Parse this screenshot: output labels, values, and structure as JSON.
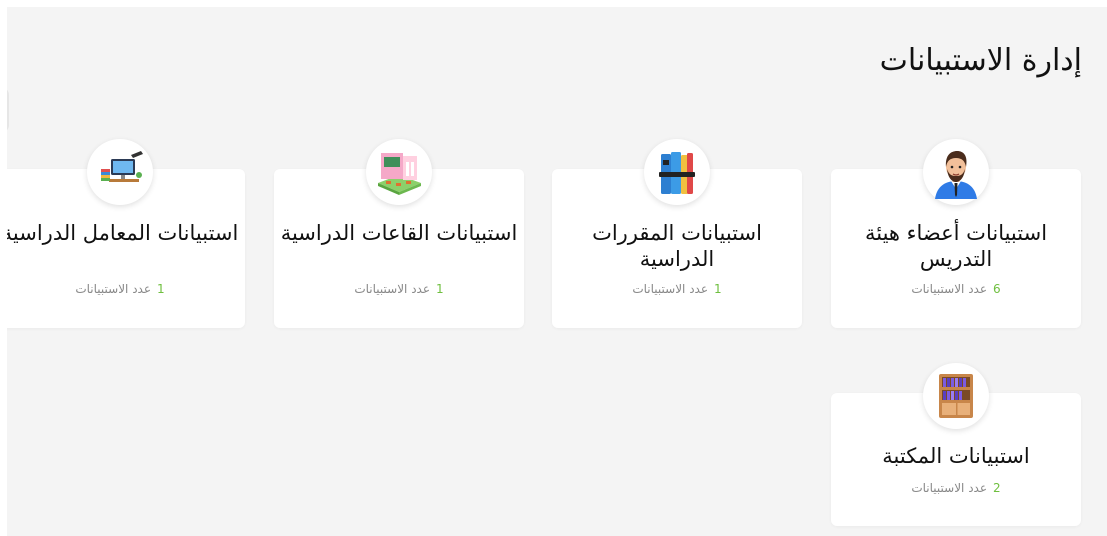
{
  "page": {
    "title": "إدارة الاستبيانات"
  },
  "cards": [
    {
      "icon": "teacher-avatar-icon",
      "title": "استبيانات أعضاء هيئة التدريس",
      "count": "6",
      "count_label": "عدد الاستبيانات"
    },
    {
      "icon": "books-icon",
      "title": "استبيانات المقررات الدراسية",
      "count": "1",
      "count_label": "عدد الاستبيانات"
    },
    {
      "icon": "classroom-icon",
      "title": "استبيانات القاعات الدراسية",
      "count": "1",
      "count_label": "عدد الاستبيانات"
    },
    {
      "icon": "lab-computer-icon",
      "title": "استبيانات المعامل الدراسية",
      "count": "1",
      "count_label": "عدد الاستبيانات"
    },
    {
      "icon": "bookshelf-icon",
      "title": "استبيانات المكتبة",
      "count": "2",
      "count_label": "عدد الاستبيانات"
    }
  ],
  "colors": {
    "count": "#6fbf3f",
    "background": "#f4f4f4",
    "card": "#ffffff"
  }
}
